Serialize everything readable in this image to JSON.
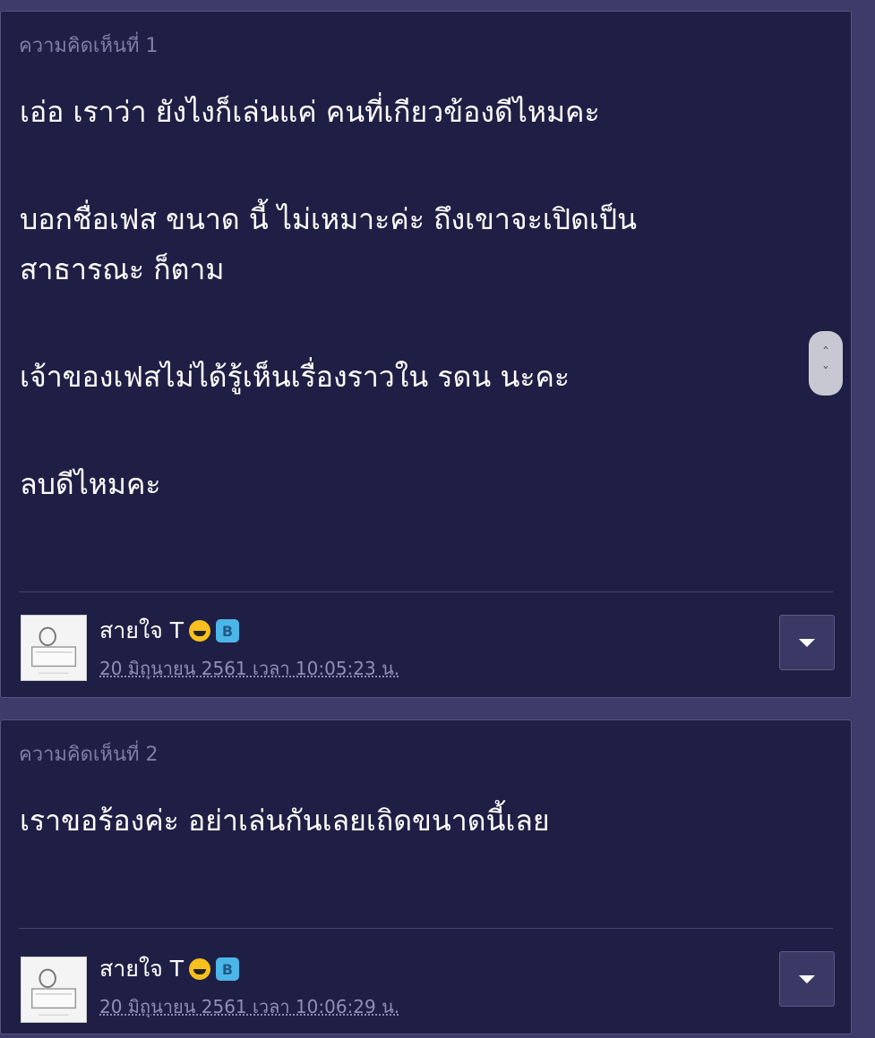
{
  "comments": [
    {
      "number_label": "ความคิดเห็นที่ 1",
      "lines": [
        "เอ่อ เราว่า ยังไงก็เล่นแค่ คนที่เกียวข้องดีไหมคะ",
        "บอกชื่อเฟส ขนาด นี้ ไม่เหมาะค่ะ  ถึงเขาจะเปิดเป็น",
        "สาธารณะ ก็ตาม",
        "เจ้าของเฟสไม่ได้รู้เห็นเรื่องราวใน รดน นะคะ",
        "ลบดีไหมคะ"
      ],
      "author": "สายใจ T",
      "badge_label": "B",
      "timestamp": "20 มิถุนายน 2561 เวลา 10:05:23 น."
    },
    {
      "number_label": "ความคิดเห็นที่ 2",
      "lines": [
        "เราขอร้องค่ะ  อย่าเล่นกันเลยเถิดขนาดนี้เลย"
      ],
      "author": "สายใจ T",
      "badge_label": "B",
      "timestamp": "20 มิถุนายน 2561 เวลา 10:06:29 น."
    }
  ],
  "scroll_widget": {
    "up_label": "ˆ",
    "down_label": "ˇ"
  },
  "icons": {
    "emoji": "laughing-face-icon",
    "badge": "b-badge-icon",
    "menu": "caret-down-icon"
  },
  "colors": {
    "background": "#3c3b6a",
    "card": "#1f1f45",
    "badge": "#4db6e8",
    "emoji": "#f7c01e"
  }
}
